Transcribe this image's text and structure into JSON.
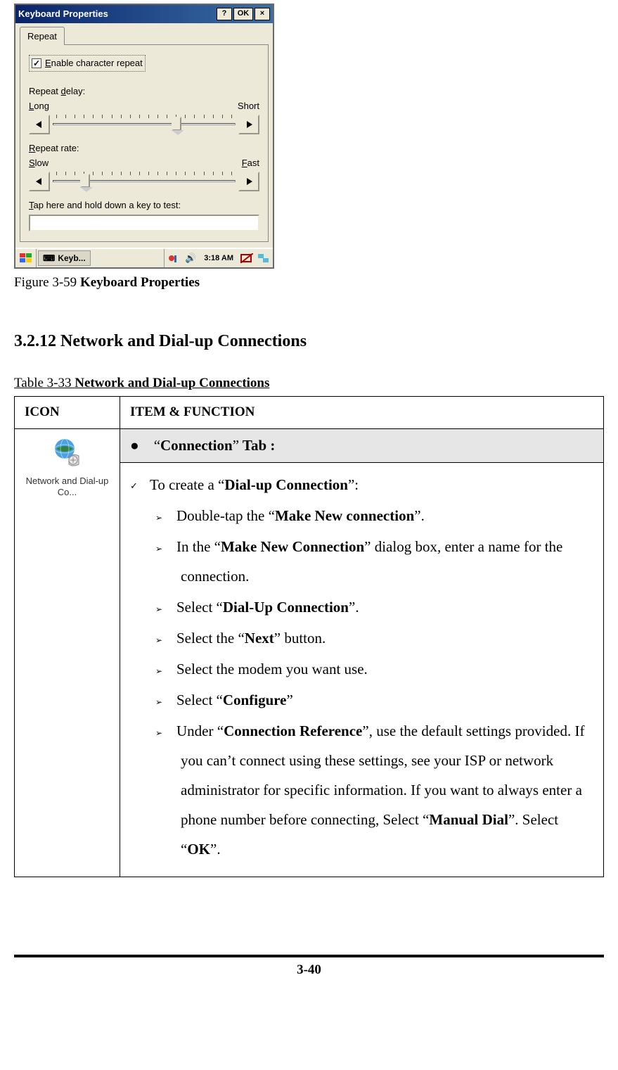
{
  "dialog": {
    "title": "Keyboard Properties",
    "buttons": {
      "help": "?",
      "ok": "OK",
      "close": "×"
    },
    "tab": "Repeat",
    "enable_checkbox_label": "Enable character repeat",
    "repeat_delay_label": "Repeat delay:",
    "delay_left": "Long",
    "delay_right": "Short",
    "repeat_rate_label": "Repeat rate:",
    "rate_left": "Slow",
    "rate_right": "Fast",
    "test_label": "Tap here and hold down a key to test:"
  },
  "taskbar": {
    "app": "Keyb...",
    "clock": "3:18 AM"
  },
  "figure": {
    "prefix": "Figure 3-59 ",
    "title": "Keyboard Properties"
  },
  "section_heading": "3.2.12 Network and Dial-up Connections",
  "table_caption_prefix": "Table 3-33 ",
  "table_caption_title": "Network and Dial-up Connections",
  "table": {
    "head_icon": "ICON",
    "head_item": "ITEM & FUNCTION",
    "icon_label": "Network and Dial-up Co...",
    "tab_row": {
      "quote1": "“",
      "name": "Connection",
      "quote2": "”",
      "suffix": " Tab :"
    },
    "steps": {
      "intro": {
        "pre": "To create a “",
        "bold": "Dial-up Connection",
        "post": "”:"
      },
      "s1": {
        "pre": "Double-tap the “",
        "bold": "Make New connection",
        "post": "”."
      },
      "s2": {
        "pre": "In the “",
        "bold": "Make New Connection",
        "post": "” dialog box, enter a name for the connection."
      },
      "s3": {
        "pre": "Select “",
        "bold": "Dial-Up Connection",
        "post": "”."
      },
      "s4": {
        "pre": "Select the “",
        "bold": "Next",
        "post": "” button."
      },
      "s5": {
        "text": "Select the modem you want use."
      },
      "s6": {
        "pre": "Select “",
        "bold": "Configure",
        "post": "”"
      },
      "s7": {
        "pre": "Under “",
        "bold1": "Connection Reference",
        "mid": "”, use the default settings provided. If you can’t connect using these settings, see your ISP or network administrator for specific information. If you want to always enter a phone number before connecting, Select “",
        "bold2": "Manual Dial",
        "mid2": "”. Select “",
        "bold3": "OK",
        "post": "”."
      }
    }
  },
  "page_number": "3-40"
}
